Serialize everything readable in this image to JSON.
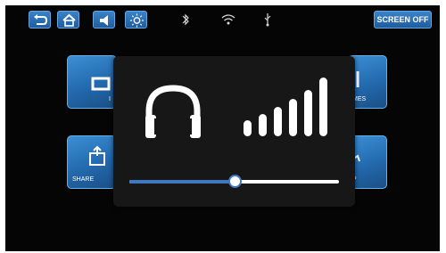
{
  "toolbar": {
    "icons": [
      "back-icon",
      "home-icon",
      "volume-icon",
      "brightness-icon"
    ],
    "screen_off_label": "SCREEN OFF"
  },
  "status": {
    "icons": [
      "bluetooth-icon",
      "wifi-icon",
      "usb-icon"
    ]
  },
  "tiles": [
    {
      "label": "I",
      "icon": "tile-icon"
    },
    {
      "label": "MES",
      "icon": "tile-icon"
    },
    {
      "label": "SHARE",
      "icon": "share-icon"
    },
    {
      "label": "P",
      "icon": "tile-icon"
    }
  ],
  "volume_popup": {
    "icon": "headphones-icon",
    "level_icon": "volume-level-bars-icon",
    "level": 0.5
  },
  "colors": {
    "accent": "#3f78c2",
    "tile": "#2b76bd",
    "popup_bg": "#171717"
  }
}
